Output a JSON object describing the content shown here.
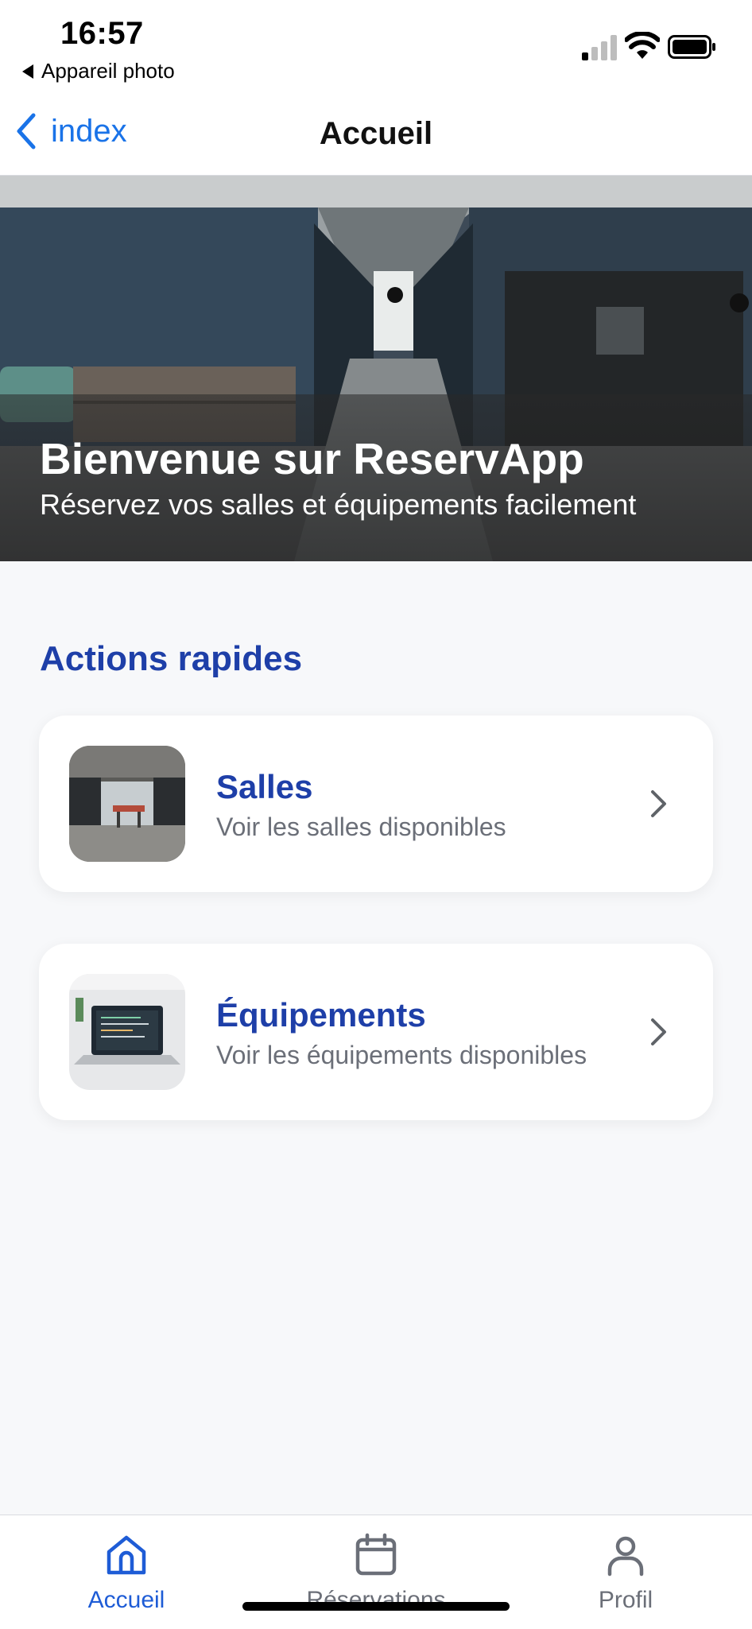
{
  "status_bar": {
    "time": "16:57",
    "back_app_label": "Appareil photo"
  },
  "nav": {
    "back_label": "index",
    "title": "Accueil"
  },
  "hero": {
    "title": "Bienvenue sur ReservApp",
    "subtitle": "Réservez vos salles et équipements facilement"
  },
  "quick_actions": {
    "title": "Actions rapides",
    "items": [
      {
        "title": "Salles",
        "subtitle": "Voir les salles disponibles",
        "thumbnail": "office-room-image"
      },
      {
        "title": "Équipements",
        "subtitle": "Voir les équipements disponibles",
        "thumbnail": "laptop-image"
      }
    ]
  },
  "tab_bar": {
    "tabs": [
      {
        "label": "Accueil",
        "icon": "home-icon",
        "active": true
      },
      {
        "label": "Réservations",
        "icon": "calendar-icon",
        "active": false
      },
      {
        "label": "Profil",
        "icon": "person-icon",
        "active": false
      }
    ]
  },
  "colors": {
    "accent": "#1e3fa8",
    "link": "#1a73e8",
    "background": "#f7f8fa",
    "muted_text": "#6b6f78"
  }
}
